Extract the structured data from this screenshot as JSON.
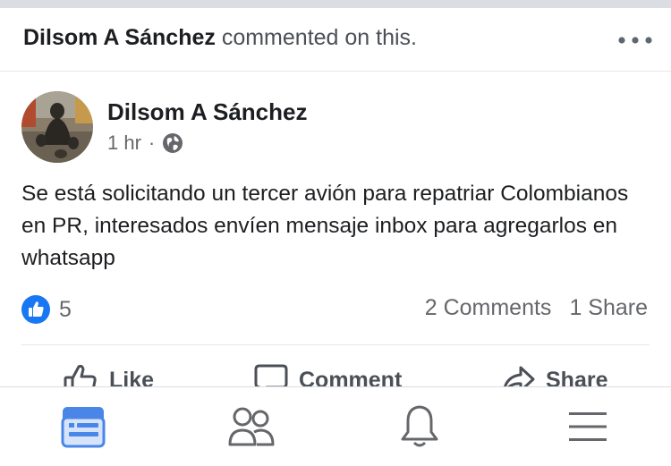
{
  "activity": {
    "name": "Dilsom A Sánchez",
    "text": "commented on this."
  },
  "post": {
    "author": "Dilsom A Sánchez",
    "time": "1 hr",
    "separator": "·",
    "privacy_icon": "globe-icon",
    "text": "Se está solicitando un tercer avión para repatriar Colombianos en PR, interesados envíen mensaje inbox para agregarlos en whatsapp"
  },
  "engagement": {
    "like_count": "5",
    "comments": "2 Comments",
    "shares": "1 Share"
  },
  "actions": {
    "like": "Like",
    "comment": "Comment",
    "share": "Share"
  },
  "nav": [
    "news-feed-icon",
    "friends-icon",
    "notifications-icon",
    "menu-icon"
  ],
  "colors": {
    "accent": "#1877f2",
    "nav_active": "#4a86e8",
    "nav_inactive": "#65676b",
    "meta_text": "#65676b"
  }
}
